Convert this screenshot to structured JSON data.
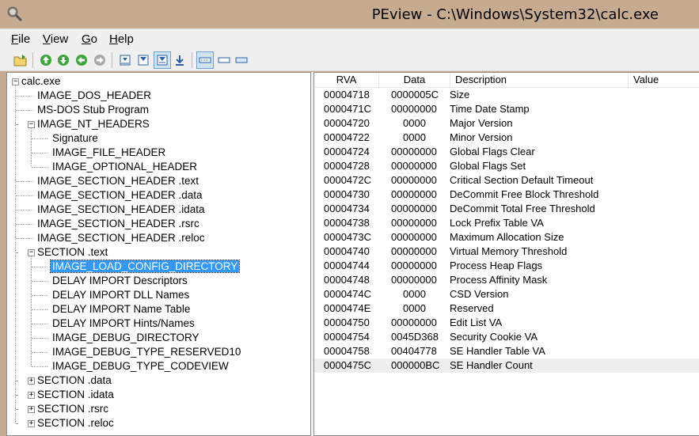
{
  "window": {
    "title": "PEview - C:\\Windows\\System32\\calc.exe"
  },
  "menu": [
    {
      "label": "File",
      "key": "F",
      "rest": "ile"
    },
    {
      "label": "View",
      "key": "V",
      "rest": "iew"
    },
    {
      "label": "Go",
      "key": "G",
      "rest": "o"
    },
    {
      "label": "Help",
      "key": "H",
      "rest": "elp"
    }
  ],
  "toolbar_icons": [
    "open-file-icon",
    "go-up-icon",
    "go-down-icon",
    "go-back-icon",
    "go-forward-icon",
    "view-byte-icon",
    "view-word-icon",
    "view-dword-icon",
    "view-qword-icon",
    "view-details-icon",
    "view-list-icon",
    "view-small-icon"
  ],
  "tree": [
    {
      "label": "calc.exe",
      "level": 0,
      "expander": "-"
    },
    {
      "label": "IMAGE_DOS_HEADER",
      "level": 1
    },
    {
      "label": "MS-DOS Stub Program",
      "level": 1
    },
    {
      "label": "IMAGE_NT_HEADERS",
      "level": 1,
      "expander": "-"
    },
    {
      "label": "Signature",
      "level": 2
    },
    {
      "label": "IMAGE_FILE_HEADER",
      "level": 2
    },
    {
      "label": "IMAGE_OPTIONAL_HEADER",
      "level": 2
    },
    {
      "label": "IMAGE_SECTION_HEADER .text",
      "level": 1
    },
    {
      "label": "IMAGE_SECTION_HEADER .data",
      "level": 1
    },
    {
      "label": "IMAGE_SECTION_HEADER .idata",
      "level": 1
    },
    {
      "label": "IMAGE_SECTION_HEADER .rsrc",
      "level": 1
    },
    {
      "label": "IMAGE_SECTION_HEADER .reloc",
      "level": 1
    },
    {
      "label": "SECTION .text",
      "level": 1,
      "expander": "-"
    },
    {
      "label": "IMAGE_LOAD_CONFIG_DIRECTORY",
      "level": 2,
      "selected": true
    },
    {
      "label": "DELAY IMPORT Descriptors",
      "level": 2
    },
    {
      "label": "DELAY IMPORT DLL Names",
      "level": 2
    },
    {
      "label": "DELAY IMPORT Name Table",
      "level": 2
    },
    {
      "label": "DELAY IMPORT Hints/Names",
      "level": 2
    },
    {
      "label": "IMAGE_DEBUG_DIRECTORY",
      "level": 2
    },
    {
      "label": "IMAGE_DEBUG_TYPE_RESERVED10",
      "level": 2
    },
    {
      "label": "IMAGE_DEBUG_TYPE_CODEVIEW",
      "level": 2
    },
    {
      "label": "SECTION .data",
      "level": 1,
      "expander": "+"
    },
    {
      "label": "SECTION .idata",
      "level": 1,
      "expander": "+"
    },
    {
      "label": "SECTION .rsrc",
      "level": 1,
      "expander": "+"
    },
    {
      "label": "SECTION .reloc",
      "level": 1,
      "expander": "+"
    }
  ],
  "columns": [
    "RVA",
    "Data",
    "Description",
    "Value"
  ],
  "rows": [
    {
      "rva": "00004718",
      "data": "0000005C",
      "desc": "Size"
    },
    {
      "rva": "0000471C",
      "data": "00000000",
      "desc": "Time Date Stamp"
    },
    {
      "rva": "00004720",
      "data": "0000",
      "desc": "Major Version"
    },
    {
      "rva": "00004722",
      "data": "0000",
      "desc": "Minor Version"
    },
    {
      "rva": "00004724",
      "data": "00000000",
      "desc": "Global Flags Clear"
    },
    {
      "rva": "00004728",
      "data": "00000000",
      "desc": "Global Flags Set"
    },
    {
      "rva": "0000472C",
      "data": "00000000",
      "desc": "Critical Section Default Timeout"
    },
    {
      "rva": "00004730",
      "data": "00000000",
      "desc": "DeCommit Free Block Threshold"
    },
    {
      "rva": "00004734",
      "data": "00000000",
      "desc": "DeCommit Total Free Threshold"
    },
    {
      "rva": "00004738",
      "data": "00000000",
      "desc": "Lock Prefix Table VA"
    },
    {
      "rva": "0000473C",
      "data": "00000000",
      "desc": "Maximum Allocation Size"
    },
    {
      "rva": "00004740",
      "data": "00000000",
      "desc": "Virtual Memory Threshold"
    },
    {
      "rva": "00004744",
      "data": "00000000",
      "desc": "Process Heap Flags"
    },
    {
      "rva": "00004748",
      "data": "00000000",
      "desc": "Process Affinity Mask"
    },
    {
      "rva": "0000474C",
      "data": "0000",
      "desc": "CSD Version"
    },
    {
      "rva": "0000474E",
      "data": "0000",
      "desc": "Reserved"
    },
    {
      "rva": "00004750",
      "data": "00000000",
      "desc": "Edit List VA"
    },
    {
      "rva": "00004754",
      "data": "0045D368",
      "desc": "Security Cookie VA"
    },
    {
      "rva": "00004758",
      "data": "00404778",
      "desc": "SE Handler Table VA"
    },
    {
      "rva": "0000475C",
      "data": "000000BC",
      "desc": "SE Handler Count",
      "highlight": true
    }
  ],
  "colors": {
    "titlebar": "#c6ab91",
    "selection": "#3399ff",
    "chrome": "#f0f0f0",
    "row_highlight": "#efefef"
  }
}
